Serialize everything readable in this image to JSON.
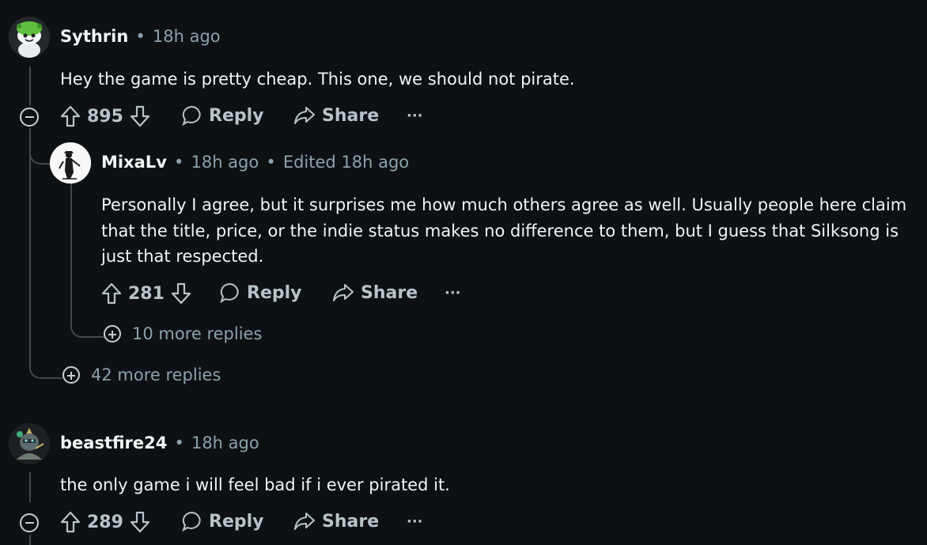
{
  "comments": [
    {
      "author": "Sythrin",
      "sep": "•",
      "time": "18h ago",
      "body": "Hey the game is pretty cheap. This one, we should not pirate.",
      "votes": "895",
      "reply_label": "Reply",
      "share_label": "Share",
      "more_label": "···",
      "more_replies": "42 more replies"
    },
    {
      "author": "MixaLv",
      "sep": "•",
      "time": "18h ago",
      "sep2": "•",
      "edited": "Edited 18h ago",
      "body": "Personally I agree, but it surprises me how much others agree as well. Usually people here claim that the title, price, or the indie status makes no difference to them, but I guess that Silksong is just that respected.",
      "votes": "281",
      "reply_label": "Reply",
      "share_label": "Share",
      "more_label": "···",
      "more_replies": "10 more replies"
    },
    {
      "author": "beastfire24",
      "sep": "•",
      "time": "18h ago",
      "body": "the only game i will feel bad if i ever pirated it.",
      "votes": "289",
      "reply_label": "Reply",
      "share_label": "Share",
      "more_label": "···"
    }
  ],
  "icons": {
    "upvote": "upvote-arrow-icon",
    "downvote": "downvote-arrow-icon",
    "reply": "speech-bubble-icon",
    "share": "share-arrow-icon",
    "collapse": "minus-circle-icon",
    "expand": "plus-circle-icon"
  },
  "colors": {
    "background": "#0e1113",
    "text": "#f2f4f5",
    "muted": "#8ba2ad",
    "thread": "#3e4a50"
  }
}
